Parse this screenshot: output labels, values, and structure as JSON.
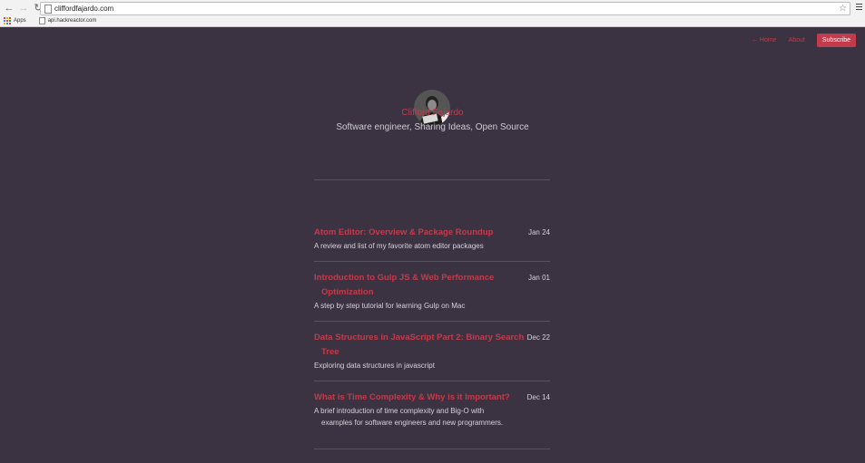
{
  "browser": {
    "url": "cliffordfajardo.com",
    "bookmarks": [
      {
        "label": "Apps"
      },
      {
        "label": "api.hackreactor.com"
      }
    ]
  },
  "site": {
    "nav": {
      "home_label": "← Home",
      "about_label": "About",
      "subscribe_label": "Subscribe"
    },
    "author": {
      "name": "Clifford Fajardo",
      "tagline": "Software engineer, Sharing Ideas, Open Source"
    },
    "posts": [
      {
        "title": "Atom Editor: Overview & Package Roundup",
        "date": "Jan 24",
        "description": "A review and list of my favorite atom editor packages"
      },
      {
        "title": "Introduction to Gulp JS & Web Performance Optimization",
        "date": "Jan 01",
        "description": "A step by step tutorial for learning Gulp on Mac"
      },
      {
        "title": "Data Structures in JavaScript Part 2: Binary Search Tree",
        "date": "Dec 22",
        "description": "Exploring data structures in javascript"
      },
      {
        "title": "What is Time Complexity & Why is it Important?",
        "date": "Dec 14",
        "description": "A brief introduction of time complexity and Big-O with examples for software engineers and new programmers."
      }
    ]
  },
  "colors": {
    "background": "#3b3342",
    "accent": "#c23b4c",
    "text": "#d6d1da"
  }
}
